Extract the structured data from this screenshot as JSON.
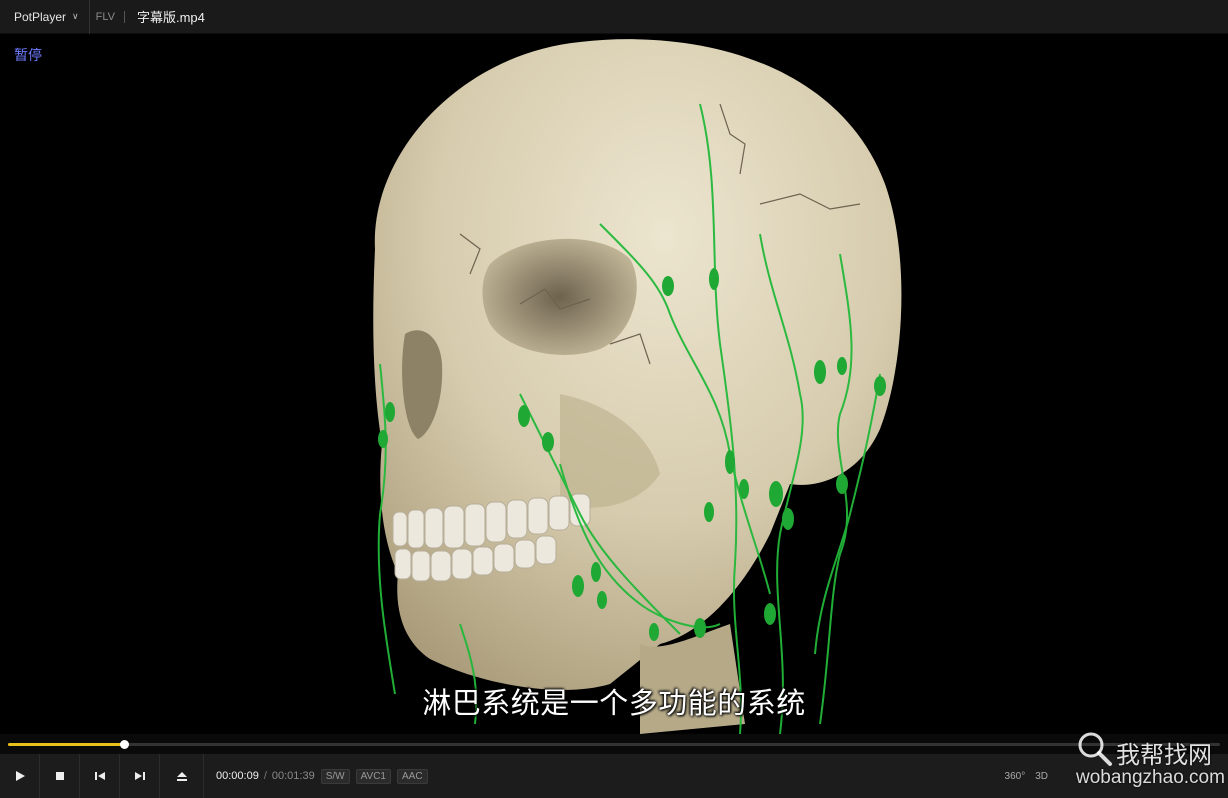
{
  "titlebar": {
    "app_name": "PotPlayer",
    "format": "FLV",
    "file_name": "字幕版.mp4"
  },
  "video": {
    "status_osd": "暂停",
    "subtitle": "淋巴系统是一个多功能的系统"
  },
  "playback": {
    "current_time": "00:00:09",
    "separator": "/",
    "total_time": "00:01:39",
    "progress": 0.096,
    "badges": [
      "S/W",
      "AVC1",
      "AAC"
    ]
  },
  "tools": {
    "vr": "360°",
    "stereo": "3D"
  },
  "watermark": {
    "cn": "我帮找网",
    "en": "wobangzhao.com"
  },
  "colors": {
    "accent": "#e8c21a",
    "osd": "#6e7cff",
    "bone": "#d8cfb4",
    "lymph": "#22b83a"
  },
  "icons": [
    "play-icon",
    "stop-icon",
    "previous-icon",
    "next-icon",
    "eject-icon",
    "search-icon"
  ]
}
